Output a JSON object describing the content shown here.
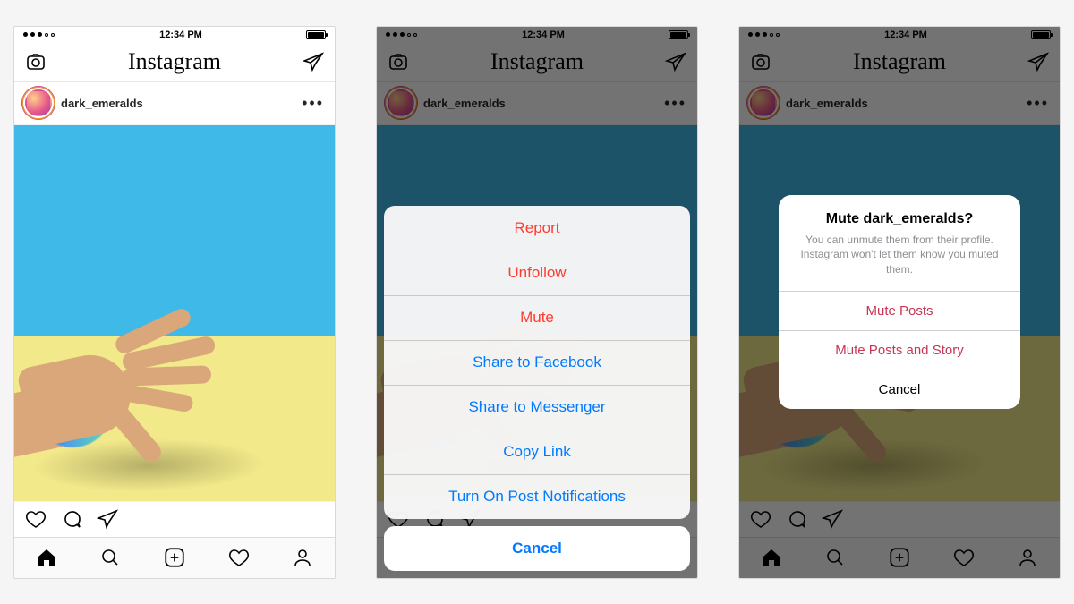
{
  "status": {
    "time": "12:34 PM"
  },
  "app": {
    "logo": "Instagram"
  },
  "post": {
    "username": "dark_emeralds"
  },
  "actionSheet": {
    "options": [
      {
        "label": "Report",
        "style": "destructive"
      },
      {
        "label": "Unfollow",
        "style": "destructive"
      },
      {
        "label": "Mute",
        "style": "destructive"
      },
      {
        "label": "Share to Facebook",
        "style": "default"
      },
      {
        "label": "Share to Messenger",
        "style": "default"
      },
      {
        "label": "Copy Link",
        "style": "default"
      },
      {
        "label": "Turn On Post Notifications",
        "style": "default"
      }
    ],
    "cancel": "Cancel"
  },
  "muteDialog": {
    "title": "Mute dark_emeralds?",
    "message": "You can unmute them from their profile. Instagram won't let them know you muted them.",
    "options": [
      {
        "label": "Mute Posts",
        "style": "destructive"
      },
      {
        "label": "Mute Posts and Story",
        "style": "destructive"
      },
      {
        "label": "Cancel",
        "style": "cancel"
      }
    ]
  }
}
